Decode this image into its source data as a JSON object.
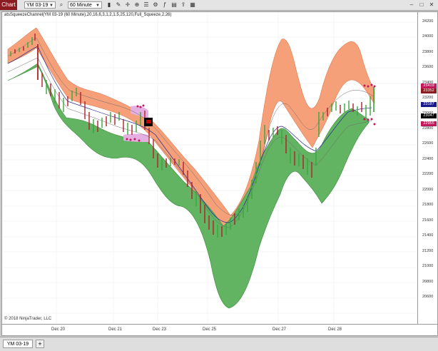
{
  "toolbar": {
    "chart_tab": "Chart",
    "instrument": "YM 03-19",
    "interval": "60 Minute",
    "icons": [
      "search-icon",
      "bar-style-icon",
      "pencil-icon",
      "crosshair-icon",
      "zoom-icon",
      "properties-icon",
      "strategy-icon",
      "indicators-icon",
      "template-icon",
      "share-icon",
      "layout-icon"
    ],
    "window_icons": [
      "minimize-icon",
      "maximize-icon",
      "close-icon"
    ]
  },
  "indicator_label": "atsSqueezeChannel(YM 03-19 (60 Minute),20,16,6,3,1,2,1.5,25,120,Full_Squeeze,2,26)",
  "copyright": "© 2018 NinjaTrader, LLC",
  "yaxis_ticks": [
    "24200",
    "24000",
    "23800",
    "23600",
    "23400",
    "23200",
    "23000",
    "22800",
    "22600",
    "22400",
    "22200",
    "22000",
    "21800",
    "21600",
    "21400",
    "21200",
    "21000",
    "20800",
    "20600"
  ],
  "xaxis_ticks": [
    "Dec 20",
    "Dec 21",
    "Dec 23",
    "Dec 25",
    "Dec 27",
    "Dec 28"
  ],
  "price_labels": [
    {
      "text": "23419",
      "color": "#c2185b"
    },
    {
      "text": "23352",
      "color": "#8b1d22"
    },
    {
      "text": "23187",
      "color": "#1a1a8c"
    },
    {
      "text": "23047",
      "color": "#000000"
    },
    {
      "text": "22955",
      "color": "#c2185b"
    }
  ],
  "bottom_tab": "YM 03-19",
  "add_tab": "+",
  "colors": {
    "upper_band": "#f6a07a",
    "lower_band": "#62b462",
    "squeeze": "#e4b0e4",
    "center": "#2b2b90",
    "up_bar": "#3aa53a",
    "down_bar": "#b0202a",
    "accent": "#8b1d22"
  }
}
